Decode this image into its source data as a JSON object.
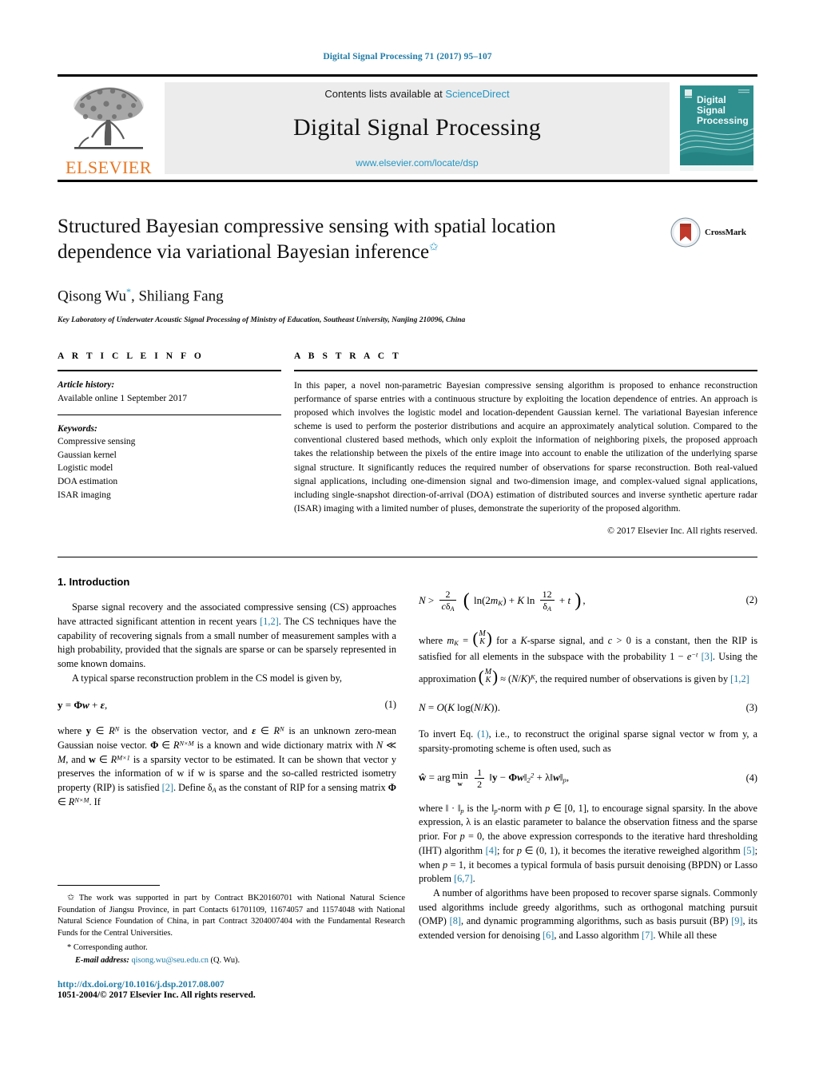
{
  "running_head": "Digital Signal Processing 71 (2017) 95–107",
  "masthead": {
    "publisher_name": "ELSEVIER",
    "contents_prefix": "Contents lists available at ",
    "sciencedirect": "ScienceDirect",
    "journal_title": "Digital Signal Processing",
    "journal_url": "www.elsevier.com/locate/dsp",
    "cover_title_lines": [
      "Digital",
      "Signal",
      "Processing"
    ],
    "accent_blue": "#2196c4",
    "elsevier_orange": "#E87722",
    "cover_teal": "#2f8f8f"
  },
  "title_block": {
    "title": "Structured Bayesian compressive sensing with spatial location dependence via variational Bayesian inference",
    "title_footnote_marker": "✩",
    "authors": "Qisong Wu",
    "author_marker": "*",
    "authors_rest": ", Shiliang Fang",
    "affiliation": "Key Laboratory of Underwater Acoustic Signal Processing of Ministry of Education, Southeast University, Nanjing 210096, China",
    "crossmark_label": "CrossMark"
  },
  "article_info": {
    "heading": "A R T I C L E  I N F O",
    "history_label": "Article history:",
    "history_value": "Available online 1 September 2017",
    "keywords_label": "Keywords:",
    "keywords": [
      "Compressive sensing",
      "Gaussian kernel",
      "Logistic model",
      "DOA estimation",
      "ISAR imaging"
    ]
  },
  "abstract": {
    "heading": "A B S T R A C T",
    "text": "In this paper, a novel non-parametric Bayesian compressive sensing algorithm is proposed to enhance reconstruction performance of sparse entries with a continuous structure by exploiting the location dependence of entries. An approach is proposed which involves the logistic model and location-dependent Gaussian kernel. The variational Bayesian inference scheme is used to perform the posterior distributions and acquire an approximately analytical solution. Compared to the conventional clustered based methods, which only exploit the information of neighboring pixels, the proposed approach takes the relationship between the pixels of the entire image into account to enable the utilization of the underlying sparse signal structure. It significantly reduces the required number of observations for sparse reconstruction. Both real-valued signal applications, including one-dimension signal and two-dimension image, and complex-valued signal applications, including single-snapshot direction-of-arrival (DOA) estimation of distributed sources and inverse synthetic aperture radar (ISAR) imaging with a limited number of pluses, demonstrate the superiority of the proposed algorithm.",
    "copyright": "© 2017 Elsevier Inc. All rights reserved."
  },
  "body": {
    "section1_heading": "1. Introduction",
    "p1_part1": "Sparse signal recovery and the associated compressive sensing (CS) approaches have attracted significant attention in recent years ",
    "p1_ref1": "[1,2]",
    "p1_part2": ". The CS techniques have the capability of recovering signals from a small number of measurement samples with a high probability, provided that the signals are sparse or can be sparsely represented in some known domains.",
    "p2": "A typical sparse reconstruction problem in the CS model is given by,",
    "eq1_num": "(1)",
    "p3_part1": "where ",
    "p3_part2": " is the observation vector, and ",
    "p3_part3": " is an unknown zero-mean Gaussian noise vector. ",
    "p3_part4": " is a known and wide dictionary matrix with ",
    "p3_part5": ", and ",
    "p3_part6": " is a sparsity vector to be estimated. It can be shown that vector y preserves the information of w if w is sparse and the so-called restricted isometry property (RIP) is satisfied ",
    "p3_ref": "[2]",
    "p3_part7": ". Define δ",
    "p3_part8": " as the constant of RIP for a sensing matrix ",
    "p3_part9": ". If",
    "eq2_num": "(2)",
    "p4_part1": "where ",
    "p4_part2": " for a ",
    "p4_part3": "-sparse signal, and ",
    "p4_part4": " is a constant, then the RIP is satisfied for all elements in the subspace with the probability ",
    "p4_ref1": "[3]",
    "p4_part5": ". Using the approximation ",
    "p4_part6": ", the required number of observations is given by ",
    "p4_ref2": "[1,2]",
    "eq3_num": "(3)",
    "p5_part1": "To invert Eq. ",
    "p5_ref": "(1)",
    "p5_part2": ", i.e., to reconstruct the original sparse signal vector w from y, a sparsity-promoting scheme is often used, such as",
    "eq4_num": "(4)",
    "p6_part1": "where ‖ · ‖",
    "p6_part2": " is the l",
    "p6_part3": "-norm with ",
    "p6_part4": ", to encourage signal sparsity. In the above expression, λ is an elastic parameter to balance the observation fitness and the sparse prior. For ",
    "p6_part5": ", the above expression corresponds to the iterative hard thresholding (IHT) algorithm ",
    "p6_ref1": "[4]",
    "p6_part6": "; for ",
    "p6_part7": ", it becomes the iterative reweighed algorithm ",
    "p6_ref2": "[5]",
    "p6_part8": "; when ",
    "p6_part9": ", it becomes a typical formula of basis pursuit denoising (BPDN) or Lasso problem ",
    "p6_ref3": "[6,7]",
    "p6_part10": ".",
    "p7_part1": "A number of algorithms have been proposed to recover sparse signals. Commonly used algorithms include greedy algorithms, such as orthogonal matching pursuit (OMP) ",
    "p7_ref1": "[8]",
    "p7_part2": ", and dynamic programming algorithms, such as basis pursuit (BP) ",
    "p7_ref2": "[9]",
    "p7_part3": ", its extended version for denoising ",
    "p7_ref3": "[6]",
    "p7_part4": ", and Lasso algorithm ",
    "p7_ref4": "[7]",
    "p7_part5": ". While all these"
  },
  "footnotes": {
    "funding_marker": "✩",
    "funding": "The work was supported in part by Contract BK20160701 with National Natural Science Foundation of Jiangsu Province, in part Contacts 61701109, 11674057 and 11574048 with National Natural Science Foundation of China, in part Contract 3204007404 with the Fundamental Research Funds for the Central Universities.",
    "corresponding_marker": "*",
    "corresponding": "Corresponding author.",
    "email_label": "E-mail address:",
    "email": "qisong.wu@seu.edu.cn",
    "email_suffix": "(Q. Wu).",
    "doi": "http://dx.doi.org/10.1016/j.dsp.2017.08.007",
    "issn_line": "1051-2004/© 2017 Elsevier Inc. All rights reserved."
  }
}
